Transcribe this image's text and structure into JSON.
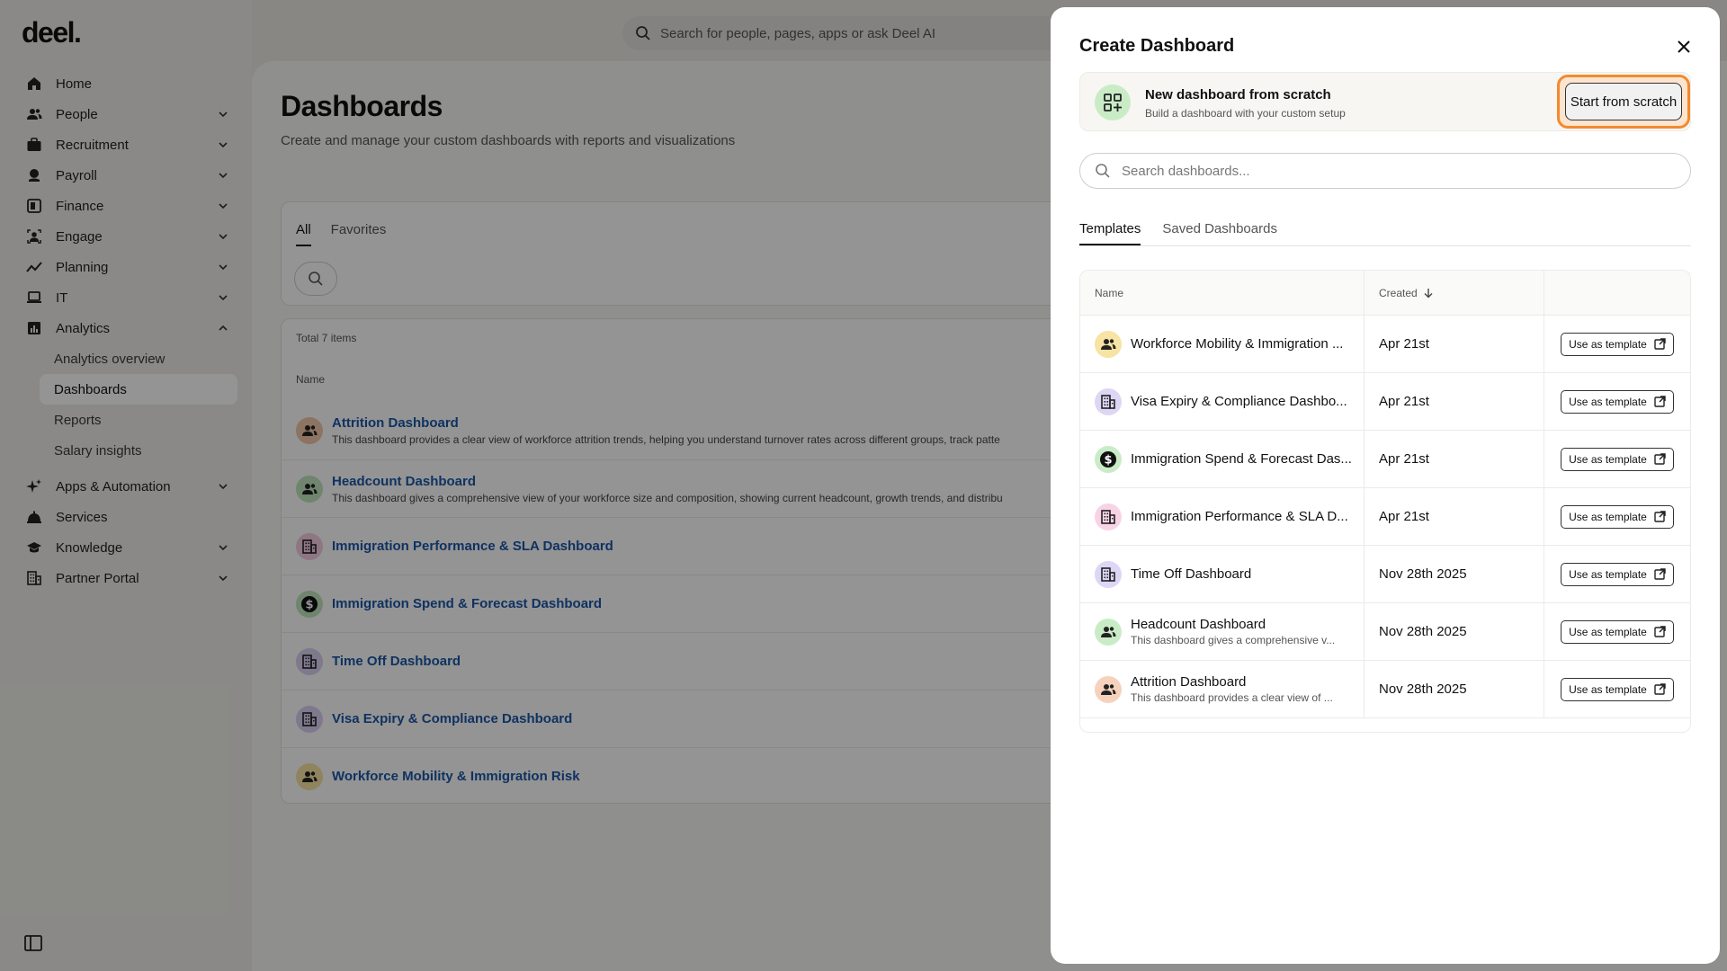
{
  "app": {
    "logo": "deel."
  },
  "top_search": {
    "placeholder": "Search for people, pages, apps or ask Deel AI"
  },
  "sidebar": {
    "items": [
      {
        "label": "Home",
        "icon": "home-icon",
        "chevron": false
      },
      {
        "label": "People",
        "icon": "people-icon",
        "chevron": true
      },
      {
        "label": "Recruitment",
        "icon": "briefcase-icon",
        "chevron": true
      },
      {
        "label": "Payroll",
        "icon": "payroll-icon",
        "chevron": true
      },
      {
        "label": "Finance",
        "icon": "finance-icon",
        "chevron": true
      },
      {
        "label": "Engage",
        "icon": "engage-icon",
        "chevron": true
      },
      {
        "label": "Planning",
        "icon": "trend-icon",
        "chevron": true
      },
      {
        "label": "IT",
        "icon": "laptop-icon",
        "chevron": true
      },
      {
        "label": "Analytics",
        "icon": "analytics-icon",
        "chevron": true,
        "expanded": true
      }
    ],
    "analytics_sub": [
      {
        "label": "Analytics overview",
        "active": false
      },
      {
        "label": "Dashboards",
        "active": true
      },
      {
        "label": "Reports",
        "active": false
      },
      {
        "label": "Salary insights",
        "active": false
      }
    ],
    "items_after": [
      {
        "label": "Apps & Automation",
        "icon": "sparkle-icon",
        "chevron": true
      },
      {
        "label": "Services",
        "icon": "services-icon",
        "chevron": false
      },
      {
        "label": "Knowledge",
        "icon": "graduation-icon",
        "chevron": true
      },
      {
        "label": "Partner Portal",
        "icon": "building-icon",
        "chevron": true
      }
    ]
  },
  "main": {
    "title": "Dashboards",
    "subtitle": "Create and manage your custom dashboards with reports and visualizations",
    "filter_tabs": [
      "All",
      "Favorites"
    ],
    "total": "Total 7 items",
    "column_name": "Name",
    "rows": [
      {
        "title": "Attrition Dashboard",
        "desc": "This dashboard provides a clear view of workforce attrition trends, helping you understand turnover rates across different groups, track patte",
        "icon": "people-icon",
        "color": "#f3c7a8"
      },
      {
        "title": "Headcount Dashboard",
        "desc": "This dashboard gives a comprehensive view of your workforce size and composition, showing current headcount, growth trends, and distribu",
        "icon": "people-icon",
        "color": "#bfe6bd"
      },
      {
        "title": "Immigration Performance & SLA Dashboard",
        "desc": "",
        "icon": "building-icon",
        "color": "#f5cbe0"
      },
      {
        "title": "Immigration Spend & Forecast Dashboard",
        "desc": "",
        "icon": "dollar-icon",
        "color": "#bfe6bd"
      },
      {
        "title": "Time Off Dashboard",
        "desc": "",
        "icon": "building-icon",
        "color": "#d9d0f3"
      },
      {
        "title": "Visa Expiry & Compliance Dashboard",
        "desc": "",
        "icon": "building-icon",
        "color": "#d9d0f3"
      },
      {
        "title": "Workforce Mobility & Immigration Risk",
        "desc": "",
        "icon": "people-icon",
        "color": "#f7e3a3"
      }
    ]
  },
  "modal": {
    "title": "Create Dashboard",
    "scratch": {
      "title": "New dashboard from scratch",
      "subtitle": "Build a dashboard with your custom setup",
      "button": "Start from scratch"
    },
    "search_placeholder": "Search dashboards...",
    "tabs": [
      "Templates",
      "Saved Dashboards"
    ],
    "columns": {
      "name": "Name",
      "created": "Created"
    },
    "use_label": "Use as template",
    "templates": [
      {
        "name": "Workforce Mobility & Immigration ...",
        "desc": "",
        "created": "Apr 21st",
        "icon": "people-icon",
        "color": "#f7e3a3"
      },
      {
        "name": "Visa Expiry & Compliance Dashbo...",
        "desc": "",
        "created": "Apr 21st",
        "icon": "building-icon",
        "color": "#ded6f5"
      },
      {
        "name": "Immigration Spend & Forecast Das...",
        "desc": "",
        "created": "Apr 21st",
        "icon": "dollar-icon",
        "color": "#c9ecc6"
      },
      {
        "name": "Immigration Performance & SLA D...",
        "desc": "",
        "created": "Apr 21st",
        "icon": "building-icon",
        "color": "#f8d3e6"
      },
      {
        "name": "Time Off Dashboard",
        "desc": "",
        "created": "Nov 28th 2025",
        "icon": "building-icon",
        "color": "#ded6f5"
      },
      {
        "name": "Headcount Dashboard",
        "desc": "This dashboard gives a comprehensive v...",
        "created": "Nov 28th 2025",
        "icon": "people-icon",
        "color": "#c9ecc6"
      },
      {
        "name": "Attrition Dashboard",
        "desc": "This dashboard provides a clear view of ...",
        "created": "Nov 28th 2025",
        "icon": "people-icon",
        "color": "#f6d2bc"
      }
    ]
  }
}
